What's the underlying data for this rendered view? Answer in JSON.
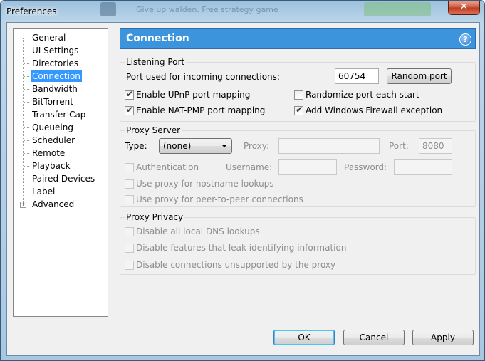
{
  "window": {
    "title": "Preferences",
    "background_hint": "Give up walden. Free strategy game",
    "close_glyph": "✕"
  },
  "sidebar": {
    "items": [
      {
        "label": "General",
        "selected": false
      },
      {
        "label": "UI Settings",
        "selected": false
      },
      {
        "label": "Directories",
        "selected": false
      },
      {
        "label": "Connection",
        "selected": true
      },
      {
        "label": "Bandwidth",
        "selected": false
      },
      {
        "label": "BitTorrent",
        "selected": false
      },
      {
        "label": "Transfer Cap",
        "selected": false
      },
      {
        "label": "Queueing",
        "selected": false
      },
      {
        "label": "Scheduler",
        "selected": false
      },
      {
        "label": "Remote",
        "selected": false
      },
      {
        "label": "Playback",
        "selected": false
      },
      {
        "label": "Paired Devices",
        "selected": false
      },
      {
        "label": "Label",
        "selected": false
      },
      {
        "label": "Advanced",
        "selected": false,
        "expandable": true
      }
    ],
    "expander_glyph": "+"
  },
  "pane": {
    "title": "Connection",
    "help_glyph": "?"
  },
  "listening_port": {
    "group_label": "Listening Port",
    "port_label": "Port used for incoming connections:",
    "port_value": "60754",
    "random_port_button": "Random port",
    "enable_upnp": {
      "label": "Enable UPnP port mapping",
      "checked": true
    },
    "enable_natpmp": {
      "label": "Enable NAT-PMP port mapping",
      "checked": true
    },
    "randomize_port": {
      "label": "Randomize port each start",
      "checked": false
    },
    "firewall_exception": {
      "label": "Add Windows Firewall exception",
      "checked": true
    }
  },
  "proxy_server": {
    "group_label": "Proxy Server",
    "type_label": "Type:",
    "type_value": "(none)",
    "proxy_label": "Proxy:",
    "proxy_value": "",
    "port_label": "Port:",
    "port_value": "8080",
    "authentication": {
      "label": "Authentication",
      "checked": false
    },
    "username_label": "Username:",
    "username_value": "",
    "password_label": "Password:",
    "password_value": "",
    "hostname_lookups": {
      "label": "Use proxy for hostname lookups",
      "checked": false
    },
    "peer_connections": {
      "label": "Use proxy for peer-to-peer connections",
      "checked": false
    }
  },
  "proxy_privacy": {
    "group_label": "Proxy Privacy",
    "disable_dns": {
      "label": "Disable all local DNS lookups",
      "checked": false
    },
    "disable_leak": {
      "label": "Disable features that leak identifying information",
      "checked": false
    },
    "disable_unsupported": {
      "label": "Disable connections unsupported by the proxy",
      "checked": false
    }
  },
  "footer": {
    "ok": "OK",
    "cancel": "Cancel",
    "apply": "Apply"
  },
  "check_glyph": "✔"
}
